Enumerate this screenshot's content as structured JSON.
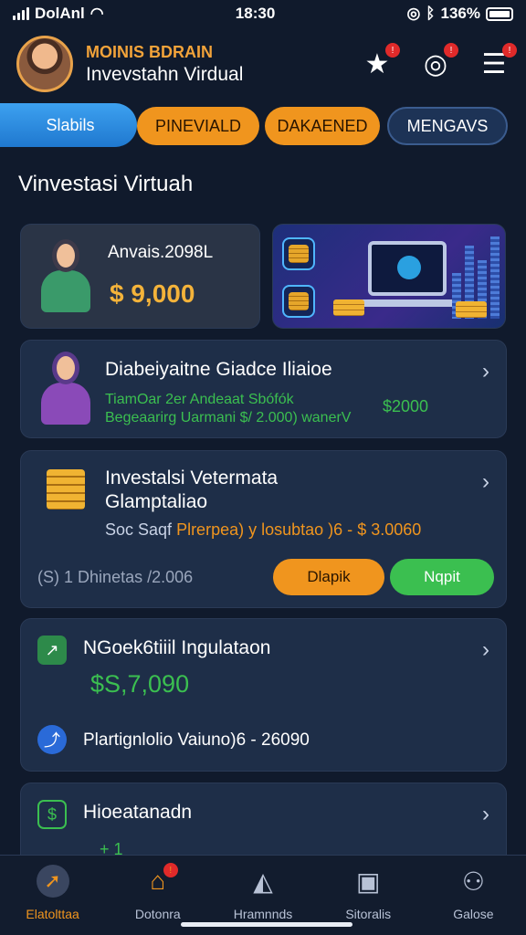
{
  "status": {
    "carrier": "DolAnl",
    "time": "18:30",
    "battery": "136%"
  },
  "header": {
    "brand_top": "MOINIS BDRAIN",
    "brand_sub": "Invevstahn Virdual",
    "notif_badge": "!"
  },
  "tabs": [
    {
      "label": "Slabils"
    },
    {
      "label": "PINEVIALD"
    },
    {
      "label": "DAKAENED"
    },
    {
      "label": "MENGAVS"
    }
  ],
  "section_title": "Vinvestasi Virtuah",
  "balance_card": {
    "label": "Anvais.2098L",
    "amount": "$ 9,000"
  },
  "card2": {
    "title": "Diabeiyaitne Giadce Iliaioe",
    "line1": "TiamOar 2er Andeaat Sbófók",
    "line2": "Begeaarirg Uarmani $/ 2.000) wanerV",
    "amount": "$2000"
  },
  "card3": {
    "title1": "Investalsi Vetermata",
    "title2": "Glamptaliao",
    "detail_prefix": "Soc Saqf",
    "detail_orange": "Plrerpea)",
    "detail_middle": "y losubtao )6 -",
    "detail_amount": "$ 3.0060",
    "footer_num": "1",
    "footer_text": "Dhinetas /2.006",
    "btn_orange": "Dlapik",
    "btn_green": "Nqpit"
  },
  "card4": {
    "title": "NGoek6tiiil Ingulataon",
    "amount": "$S,7,090",
    "line": "Plartignlolio Vaiuno)6 - 26090"
  },
  "card5": {
    "title": "Hioeatanadn",
    "partial": "+ 1"
  },
  "bottom_nav": [
    {
      "label": "Elatolttaa",
      "icon": "rocket-icon"
    },
    {
      "label": "Dotonra",
      "icon": "home-icon"
    },
    {
      "label": "Hramnnds",
      "icon": "chat-icon"
    },
    {
      "label": "Sitoralis",
      "icon": "box-icon"
    },
    {
      "label": "Galose",
      "icon": "user-icon"
    }
  ],
  "colors": {
    "accent_orange": "#f0951e",
    "accent_green": "#3bbf50",
    "accent_blue": "#3da1f0",
    "bg": "#101a2c"
  }
}
